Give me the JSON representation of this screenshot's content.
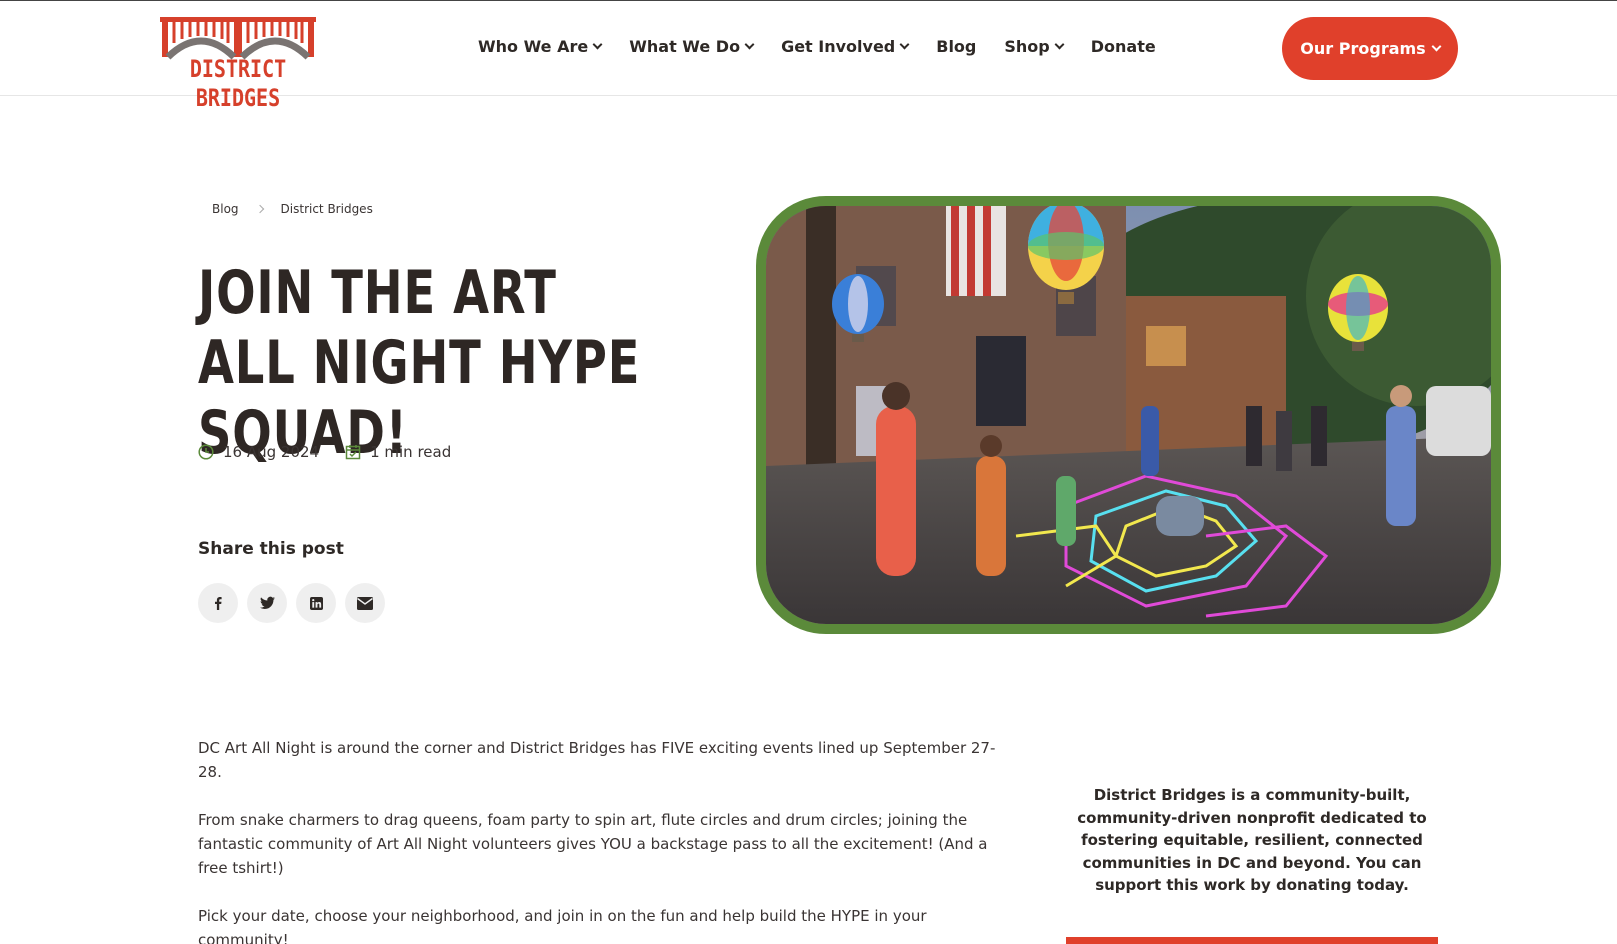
{
  "brand": {
    "logo_text": "DISTRICT BRIDGES",
    "accent": "#e0402b",
    "green": "#5b8a3a"
  },
  "nav": {
    "items": [
      {
        "label": "Who We Are",
        "has_dropdown": true
      },
      {
        "label": "What We Do",
        "has_dropdown": true
      },
      {
        "label": "Get Involved",
        "has_dropdown": true
      },
      {
        "label": "Blog",
        "has_dropdown": false
      },
      {
        "label": "Shop",
        "has_dropdown": true
      },
      {
        "label": "Donate",
        "has_dropdown": false
      }
    ],
    "cta_label": "Our Programs"
  },
  "breadcrumb": [
    "Blog",
    "District Bridges"
  ],
  "post": {
    "title": "JOIN THE ART ALL NIGHT HYPE SQUAD!",
    "date": "16 Aug 2024",
    "read_time": "1 min read",
    "share_title": "Share this post",
    "share_icons": [
      "facebook-icon",
      "twitter-icon",
      "linkedin-icon",
      "email-icon"
    ],
    "paragraphs": [
      "DC Art All Night is around the corner and District Bridges has FIVE exciting events lined up September 27-28.",
      "From snake charmers to drag queens, foam party to spin art, flute circles and drum circles; joining the fantastic community of Art All Night volunteers gives YOU a backstage pass to all the excitement! (And a free tshirt!)",
      "Pick your date, choose your neighborhood, and join in on the fun and help build the HYPE in your community!"
    ]
  },
  "sidebar": {
    "text": "District Bridges is a community-built, community-driven nonprofit dedicated to fostering equitable, resilient, connected communities in DC and beyond. You can support this work by donating today."
  }
}
